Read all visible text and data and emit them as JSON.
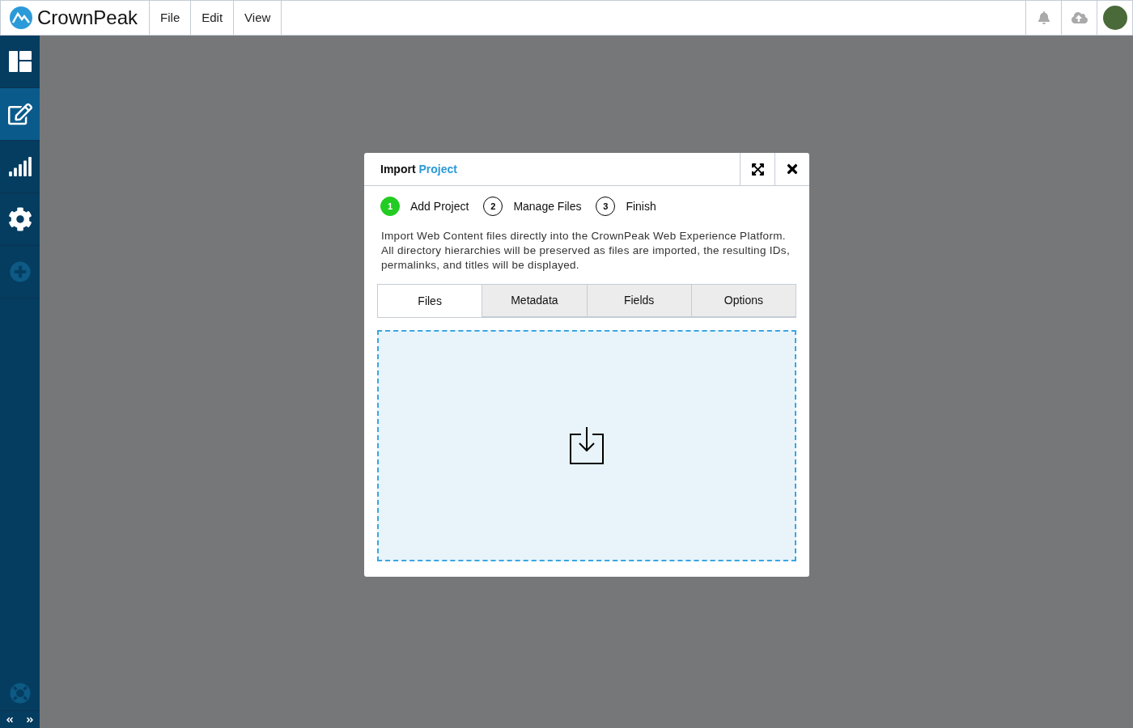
{
  "app": {
    "brand": "CrownPeak"
  },
  "menu": [
    {
      "label": "File"
    },
    {
      "label": "Edit"
    },
    {
      "label": "View"
    }
  ],
  "sidebar": {
    "items": [
      {
        "kind": "dashboard",
        "selected": false
      },
      {
        "kind": "edit",
        "selected": true
      },
      {
        "kind": "reports",
        "selected": false
      },
      {
        "kind": "settings",
        "selected": false
      },
      {
        "kind": "add",
        "selected": false
      }
    ]
  },
  "dialog": {
    "title": "Import",
    "title_accent": "Project",
    "steps": [
      {
        "number": "1",
        "label": "Add Project",
        "selected": true
      },
      {
        "number": "2",
        "label": "Manage Files",
        "selected": false
      },
      {
        "number": "3",
        "label": "Finish",
        "selected": false
      }
    ],
    "description": "Import Web Content files directly into the CrownPeak Web Experience Platform. All directory hierarchies will be preserved as files are imported, the resulting IDs, permalinks, and titles will be displayed.",
    "tabs": [
      {
        "label": "Files",
        "selected": true
      },
      {
        "label": "Metadata",
        "selected": false
      },
      {
        "label": "Fields",
        "selected": false
      },
      {
        "label": "Options",
        "selected": false
      }
    ]
  }
}
